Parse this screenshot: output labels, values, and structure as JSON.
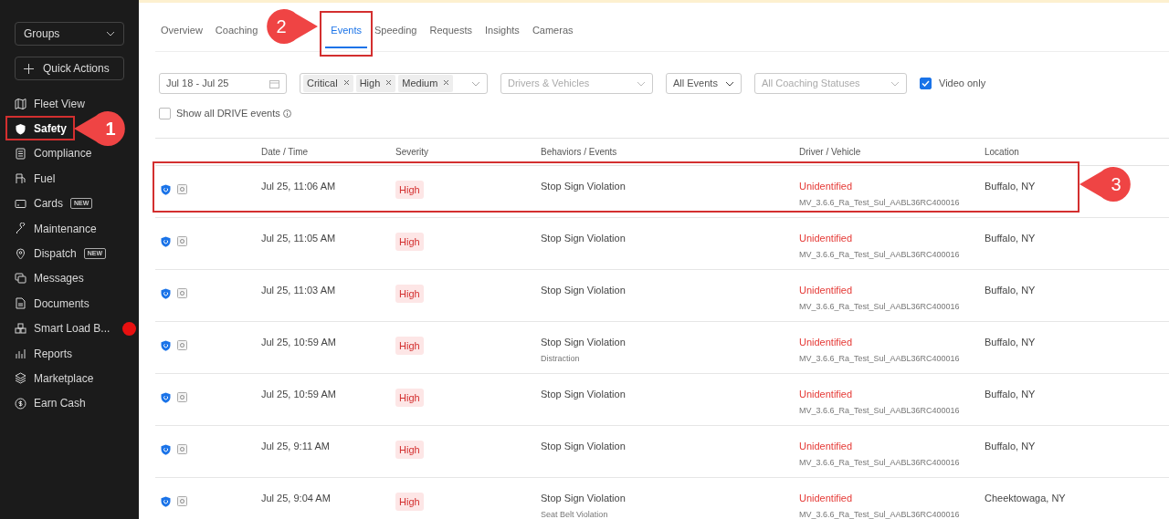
{
  "sidebar": {
    "groups_label": "Groups",
    "quick_actions_label": "Quick Actions",
    "items": [
      {
        "label": "Fleet View",
        "selected": false
      },
      {
        "label": "Safety",
        "selected": true,
        "highlighted": true,
        "callout": "1"
      },
      {
        "label": "Compliance",
        "selected": false
      },
      {
        "label": "Fuel",
        "selected": false
      },
      {
        "label": "Cards",
        "selected": false,
        "badge": "NEW"
      },
      {
        "label": "Maintenance",
        "selected": false
      },
      {
        "label": "Dispatch",
        "selected": false,
        "badge": "NEW"
      },
      {
        "label": "Messages",
        "selected": false
      },
      {
        "label": "Documents",
        "selected": false
      },
      {
        "label": "Smart Load B...",
        "selected": false,
        "notification": true
      },
      {
        "label": "Reports",
        "selected": false
      },
      {
        "label": "Marketplace",
        "selected": false
      },
      {
        "label": "Earn Cash",
        "selected": false
      }
    ]
  },
  "tabs": [
    {
      "label": "Overview",
      "selected": false
    },
    {
      "label": "Coaching",
      "selected": false
    },
    {
      "label": "Events",
      "selected": true,
      "highlighted": true,
      "callout": "2"
    },
    {
      "label": "Speeding",
      "selected": false
    },
    {
      "label": "Requests",
      "selected": false
    },
    {
      "label": "Insights",
      "selected": false
    },
    {
      "label": "Cameras",
      "selected": false
    }
  ],
  "filters": {
    "date_range": "Jul 18 - Jul 25",
    "severity_tags": [
      "Critical",
      "High",
      "Medium"
    ],
    "drivers_placeholder": "Drivers & Vehicles",
    "events_value": "All Events",
    "coaching_placeholder": "All Coaching Statuses",
    "video_only": {
      "label": "Video only",
      "checked": true
    },
    "show_all_drive": {
      "label": "Show all DRIVE events",
      "checked": false
    }
  },
  "table": {
    "columns": [
      "Date / Time",
      "Severity",
      "Behaviors / Events",
      "Driver / Vehicle",
      "Location"
    ],
    "rows": [
      {
        "date": "Jul 25, 11:06 AM",
        "severity": "High",
        "behavior": "Stop Sign Violation",
        "driver": "Unidentified",
        "vehicle": "MV_3.6.6_Ra_Test_Sul_AABL36RC400016",
        "location": "Buffalo, NY",
        "highlighted": true,
        "callout": "3"
      },
      {
        "date": "Jul 25, 11:05 AM",
        "severity": "High",
        "behavior": "Stop Sign Violation",
        "driver": "Unidentified",
        "vehicle": "MV_3.6.6_Ra_Test_Sul_AABL36RC400016",
        "location": "Buffalo, NY",
        "highlighted": false
      },
      {
        "date": "Jul 25, 11:03 AM",
        "severity": "High",
        "behavior": "Stop Sign Violation",
        "driver": "Unidentified",
        "vehicle": "MV_3.6.6_Ra_Test_Sul_AABL36RC400016",
        "location": "Buffalo, NY",
        "highlighted": false
      },
      {
        "date": "Jul 25, 10:59 AM",
        "severity": "High",
        "behavior": "Stop Sign Violation",
        "behavior_detail": "Distraction",
        "driver": "Unidentified",
        "vehicle": "MV_3.6.6_Ra_Test_Sul_AABL36RC400016",
        "location": "Buffalo, NY",
        "highlighted": false
      },
      {
        "date": "Jul 25, 10:59 AM",
        "severity": "High",
        "behavior": "Stop Sign Violation",
        "driver": "Unidentified",
        "vehicle": "MV_3.6.6_Ra_Test_Sul_AABL36RC400016",
        "location": "Buffalo, NY",
        "highlighted": false
      },
      {
        "date": "Jul 25, 9:11 AM",
        "severity": "High",
        "behavior": "Stop Sign Violation",
        "driver": "Unidentified",
        "vehicle": "MV_3.6.6_Ra_Test_Sul_AABL36RC400016",
        "location": "Buffalo, NY",
        "highlighted": false
      },
      {
        "date": "Jul 25, 9:04 AM",
        "severity": "High",
        "behavior": "Stop Sign Violation",
        "behavior_detail": "Seat Belt Violation",
        "driver": "Unidentified",
        "vehicle": "MV_3.6.6_Ra_Test_Sul_AABL36RC400016",
        "location": "Cheektowaga, NY",
        "highlighted": false
      }
    ]
  }
}
